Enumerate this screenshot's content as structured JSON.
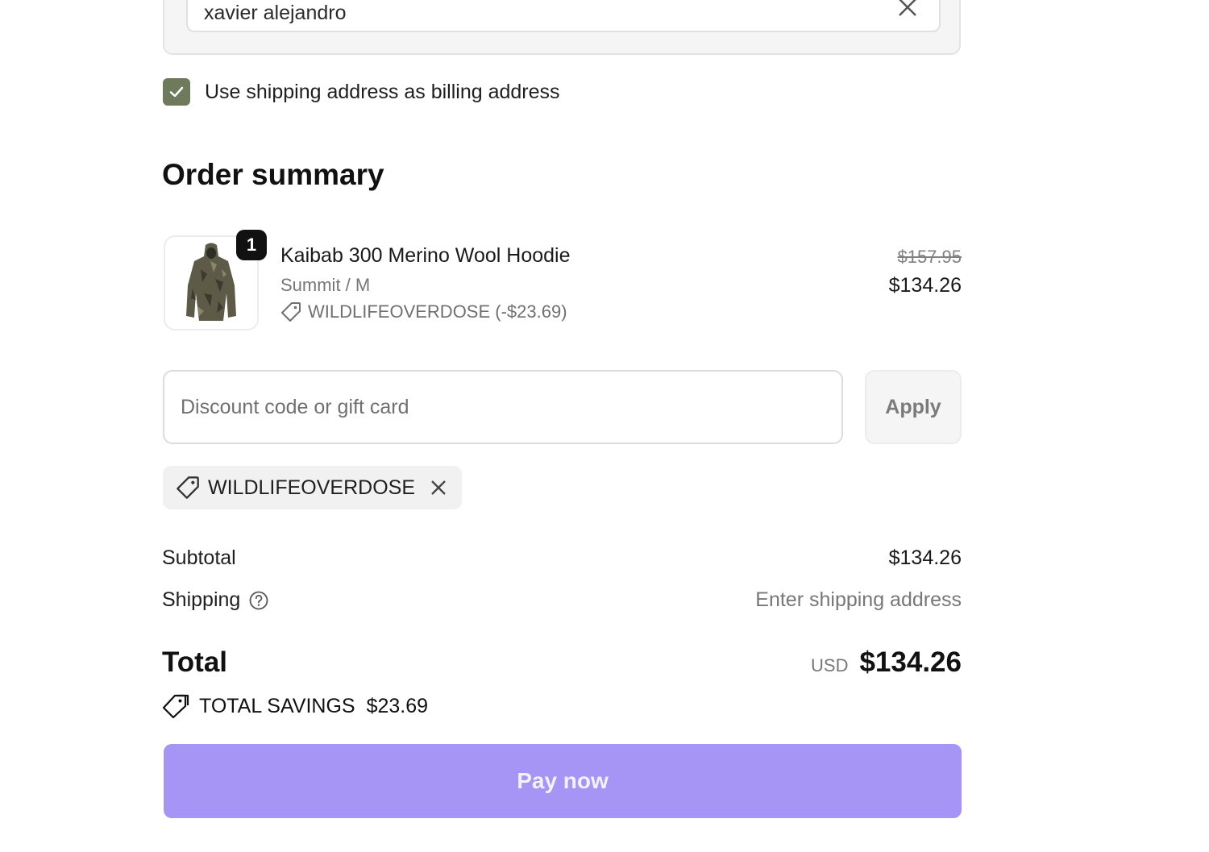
{
  "contact": {
    "name_value": "xavier alejandro",
    "clear_icon": "close-icon"
  },
  "billing": {
    "checked": true,
    "label": "Use shipping address as billing address"
  },
  "order_summary": {
    "title": "Order summary",
    "item": {
      "quantity": "1",
      "name": "Kaibab 300 Merino Wool Hoodie",
      "variant": "Summit / M",
      "discount_label": "WILDLIFEOVERDOSE (-$23.69)",
      "price_original": "$157.95",
      "price_final": "$134.26",
      "image_icon": "camo-hoodie-image"
    },
    "discount": {
      "placeholder": "Discount code or gift card",
      "apply_label": "Apply",
      "applied_code": "WILDLIFEOVERDOSE"
    },
    "subtotal_label": "Subtotal",
    "subtotal_value": "$134.26",
    "shipping_label": "Shipping",
    "shipping_value": "Enter shipping address",
    "total_label": "Total",
    "currency": "USD",
    "total_value": "$134.26",
    "savings_label": "TOTAL SAVINGS",
    "savings_value": "$23.69"
  },
  "pay_button_label": "Pay now",
  "colors": {
    "checkbox": "#6f7a5d",
    "pay_button": "#a695f5",
    "muted_text": "#777777"
  }
}
